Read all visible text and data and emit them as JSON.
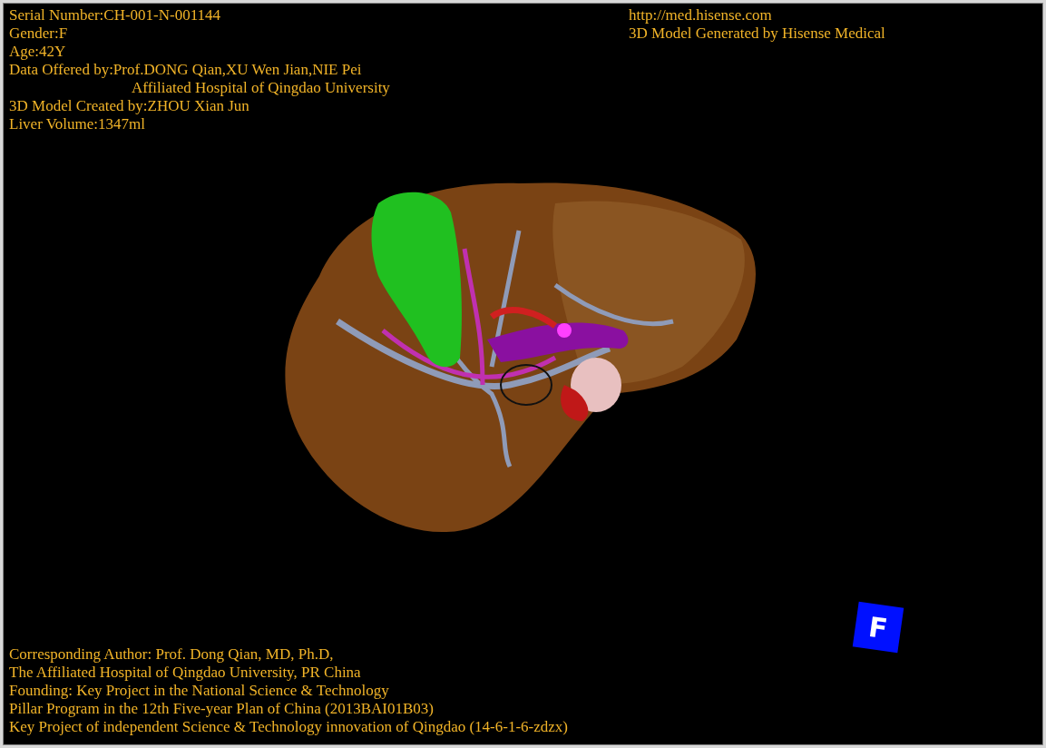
{
  "info_top_left": [
    {
      "lines": [
        "Serial Number:CH-001-N-001144"
      ]
    },
    {
      "lines": [
        "Gender:F"
      ]
    },
    {
      "lines": [
        "Age:42Y"
      ]
    },
    {
      "lines": [
        "Data Offered by:Prof.DONG Qian,XU Wen Jian,NIE Pei",
        "Affiliated Hospital of Qingdao University"
      ]
    },
    {
      "lines": [
        "3D Model Created by:ZHOU Xian Jun"
      ]
    },
    {
      "lines": [
        "Liver Volume:1347ml"
      ]
    }
  ],
  "info_top_right": [
    "http://med.hisense.com",
    "3D Model Generated by Hisense Medical"
  ],
  "model_view": {
    "kind": "picture"
  },
  "info_bottom": [
    "Corresponding Author: Prof. Dong Qian, MD, Ph.D,",
    "The Affiliated Hospital of Qingdao University, PR China",
    "Founding: Key Project in the National Science & Technology",
    "Pillar Program in the 12th Five-year Plan of China (2013BAI01B03)",
    "Key Project of independent Science & Technology innovation of Qingdao (14-6-1-6-zdzx)"
  ],
  "orientation_marker": {
    "label": "F"
  }
}
